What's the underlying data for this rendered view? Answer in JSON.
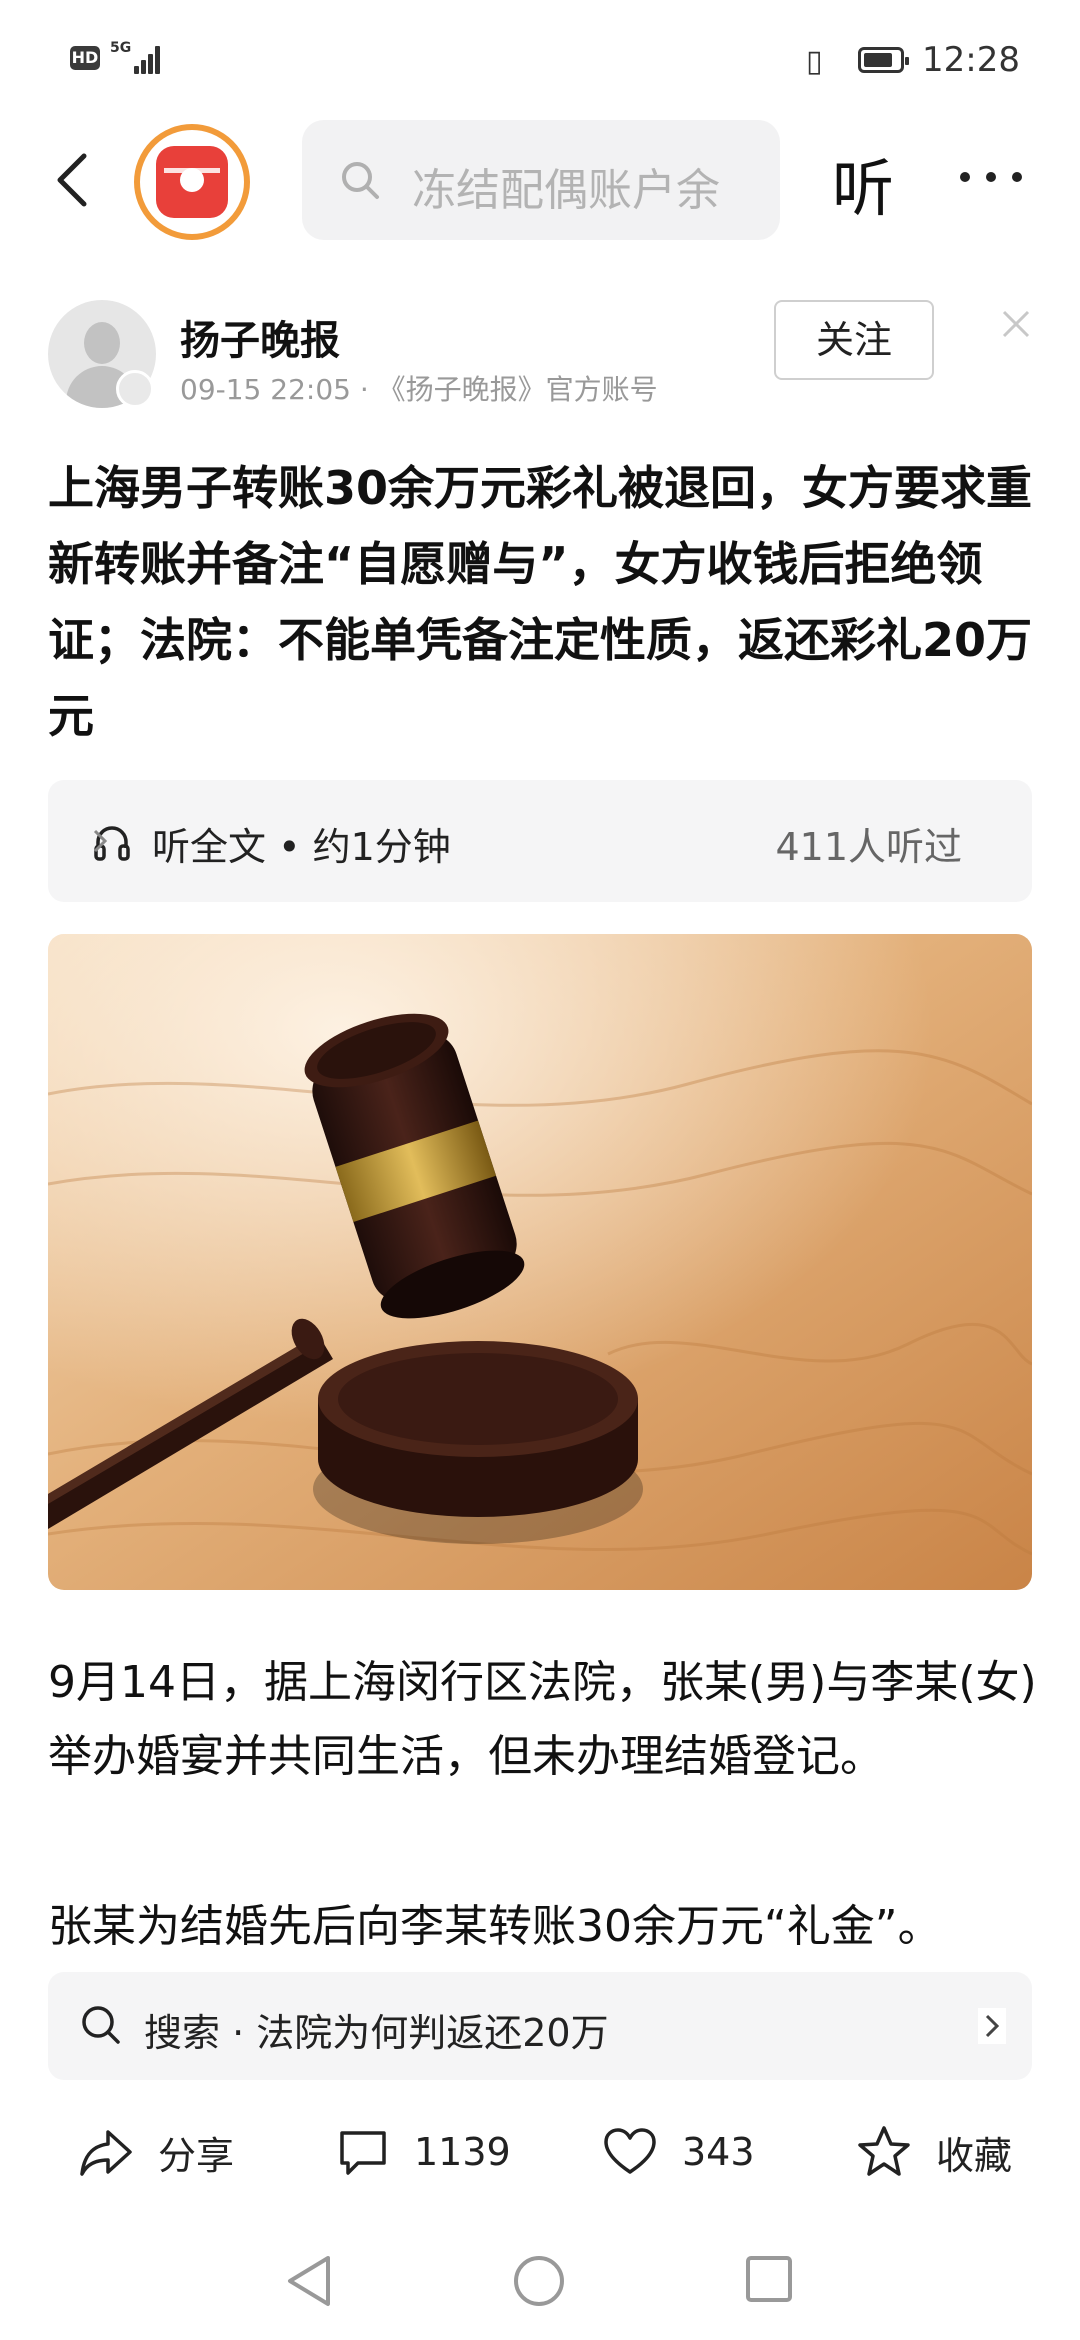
{
  "status_bar": {
    "hd_label": "HD",
    "network_label": "5G",
    "time": "12:28"
  },
  "top_nav": {
    "search_placeholder": "冻结配偶账户余",
    "listen_label": "听"
  },
  "author": {
    "name": "扬子晚报",
    "meta": "09-15 22:05 · 《扬子晚报》官方账号",
    "follow_label": "关注"
  },
  "article": {
    "title": "上海男子转账30余万元彩礼被退回，女方要求重新转账并备注“自愿赠与”，女方收钱后拒绝领证；法院：不能单凭备注定性质，返还彩礼20万元",
    "listen_full": "听全文 • 约1分钟",
    "listen_count": "411人听过",
    "paragraph_1": "9月14日，据上海闵行区法院，张某(男)与李某(女)举办婚宴并共同生活，但未办理结婚登记。",
    "paragraph_2": "张某为结婚先后向李某转账30余万元“礼金”。"
  },
  "search_suggest": {
    "text": "搜索 · 法院为何判返还20万"
  },
  "actions": {
    "share": "分享",
    "comments": "1139",
    "likes": "343",
    "favorite": "收藏"
  },
  "colors": {
    "accent_orange": "#f29b3a",
    "app_red": "#e8403a"
  }
}
